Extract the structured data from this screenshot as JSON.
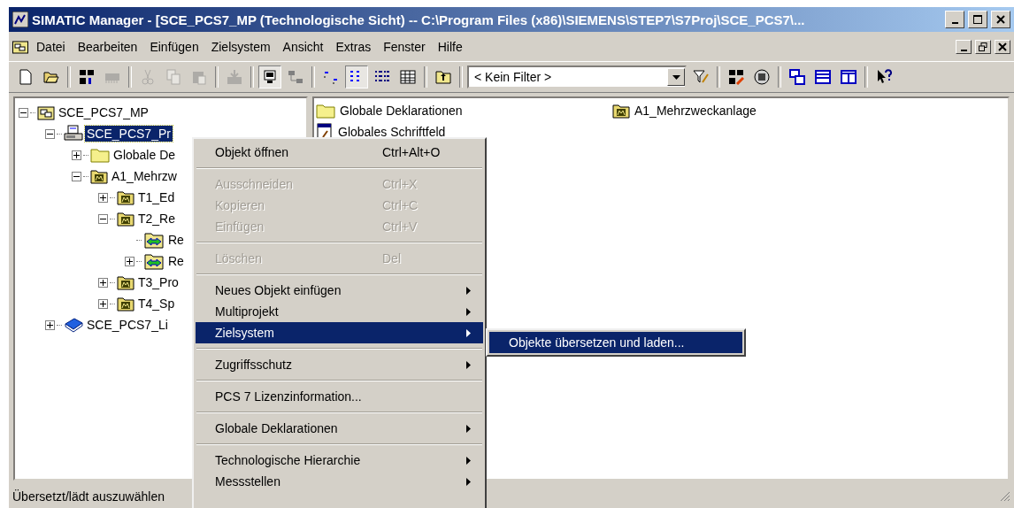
{
  "window": {
    "title": "SIMATIC Manager - [SCE_PCS7_MP (Technologische Sicht) -- C:\\Program Files (x86)\\SIEMENS\\STEP7\\S7Proj\\SCE_PCS7\\..."
  },
  "menu_bar": [
    "Datei",
    "Bearbeiten",
    "Einfügen",
    "Zielsystem",
    "Ansicht",
    "Extras",
    "Fenster",
    "Hilfe"
  ],
  "toolbar": [
    {
      "kind": "new",
      "pressed": false,
      "disabled": false
    },
    {
      "kind": "open",
      "pressed": false,
      "disabled": false
    },
    {
      "kind": "separator"
    },
    {
      "kind": "nodes",
      "pressed": false,
      "disabled": false
    },
    {
      "kind": "memory-card",
      "pressed": false,
      "disabled": true
    },
    {
      "kind": "separator"
    },
    {
      "kind": "cut",
      "pressed": false,
      "disabled": true
    },
    {
      "kind": "copy",
      "pressed": false,
      "disabled": true
    },
    {
      "kind": "paste",
      "pressed": false,
      "disabled": true
    },
    {
      "kind": "separator"
    },
    {
      "kind": "download",
      "pressed": false,
      "disabled": true
    },
    {
      "kind": "separator"
    },
    {
      "kind": "offline",
      "pressed": true,
      "disabled": false
    },
    {
      "kind": "online",
      "pressed": false,
      "disabled": false
    },
    {
      "kind": "separator"
    },
    {
      "kind": "large-icons",
      "pressed": false,
      "disabled": false
    },
    {
      "kind": "small-icons",
      "pressed": true,
      "disabled": false
    },
    {
      "kind": "list",
      "pressed": false,
      "disabled": false
    },
    {
      "kind": "details",
      "pressed": false,
      "disabled": false
    },
    {
      "kind": "separator"
    },
    {
      "kind": "up-level",
      "pressed": false,
      "disabled": false
    },
    {
      "kind": "separator"
    },
    {
      "kind": "filter-select",
      "value": "< Kein Filter >"
    },
    {
      "kind": "filter",
      "pressed": false,
      "disabled": false
    },
    {
      "kind": "separator"
    },
    {
      "kind": "network",
      "pressed": false,
      "disabled": false
    },
    {
      "kind": "simulation",
      "pressed": false,
      "disabled": false
    },
    {
      "kind": "separator"
    },
    {
      "kind": "cascade",
      "pressed": false,
      "disabled": false
    },
    {
      "kind": "tile-horizontal",
      "pressed": false,
      "disabled": false
    },
    {
      "kind": "tile-vertical",
      "pressed": false,
      "disabled": false
    },
    {
      "kind": "separator"
    },
    {
      "kind": "help",
      "pressed": false,
      "disabled": false
    }
  ],
  "tree": [
    {
      "label": "SCE_PCS7_MP",
      "kind": "multiproject",
      "expanded": true,
      "selected": false,
      "children": [
        {
          "label": "SCE_PCS7_Pr",
          "kind": "project",
          "expanded": true,
          "selected": true,
          "children": [
            {
              "label": "Globale De",
              "kind": "folder",
              "expanded": false,
              "selected": false
            },
            {
              "label": "A1_Mehrzw",
              "kind": "plant",
              "expanded": true,
              "selected": false,
              "children": [
                {
                  "label": "T1_Ed",
                  "kind": "plant",
                  "expanded": false,
                  "selected": false
                },
                {
                  "label": "T2_Re",
                  "kind": "plant",
                  "expanded": true,
                  "selected": false,
                  "children": [
                    {
                      "label": "Re",
                      "kind": "picture",
                      "selected": false
                    },
                    {
                      "label": "Re",
                      "kind": "picture",
                      "expanded": false,
                      "selected": false
                    }
                  ]
                },
                {
                  "label": "T3_Pro",
                  "kind": "plant",
                  "expanded": false,
                  "selected": false
                },
                {
                  "label": "T4_Sp",
                  "kind": "plant",
                  "expanded": false,
                  "selected": false
                }
              ]
            }
          ]
        },
        {
          "label": "SCE_PCS7_Li",
          "kind": "library",
          "expanded": false,
          "selected": false
        }
      ]
    }
  ],
  "list": [
    {
      "label": "Globale Deklarationen",
      "kind": "folder"
    },
    {
      "label": "Globales Schriftfeld",
      "kind": "form"
    },
    {
      "label": "A1_Mehrzweckanlage",
      "kind": "plant"
    }
  ],
  "context_menu": [
    {
      "kind": "item",
      "label": "Objekt öffnen",
      "shortcut": "Ctrl+Alt+O",
      "disabled": false,
      "submenu": false,
      "selected": false
    },
    {
      "kind": "separator"
    },
    {
      "kind": "item",
      "label": "Ausschneiden",
      "shortcut": "Ctrl+X",
      "disabled": true,
      "submenu": false,
      "selected": false
    },
    {
      "kind": "item",
      "label": "Kopieren",
      "shortcut": "Ctrl+C",
      "disabled": true,
      "submenu": false,
      "selected": false
    },
    {
      "kind": "item",
      "label": "Einfügen",
      "shortcut": "Ctrl+V",
      "disabled": true,
      "submenu": false,
      "selected": false
    },
    {
      "kind": "separator"
    },
    {
      "kind": "item",
      "label": "Löschen",
      "shortcut": "Del",
      "disabled": true,
      "submenu": false,
      "selected": false
    },
    {
      "kind": "separator"
    },
    {
      "kind": "item",
      "label": "Neues Objekt einfügen",
      "disabled": false,
      "submenu": true,
      "selected": false
    },
    {
      "kind": "item",
      "label": "Multiprojekt",
      "disabled": false,
      "submenu": true,
      "selected": false
    },
    {
      "kind": "item",
      "label": "Zielsystem",
      "disabled": false,
      "submenu": true,
      "selected": true
    },
    {
      "kind": "separator"
    },
    {
      "kind": "item",
      "label": "Zugriffsschutz",
      "disabled": false,
      "submenu": true,
      "selected": false
    },
    {
      "kind": "separator"
    },
    {
      "kind": "item",
      "label": "PCS 7 Lizenzinformation...",
      "disabled": false,
      "submenu": false,
      "selected": false
    },
    {
      "kind": "separator"
    },
    {
      "kind": "item",
      "label": "Globale Deklarationen",
      "disabled": false,
      "submenu": true,
      "selected": false
    },
    {
      "kind": "separator"
    },
    {
      "kind": "item",
      "label": "Technologische Hierarchie",
      "disabled": false,
      "submenu": true,
      "selected": false
    },
    {
      "kind": "item",
      "label": "Messstellen",
      "disabled": false,
      "submenu": true,
      "selected": false
    }
  ],
  "submenu": [
    {
      "label": "Objekte übersetzen und laden...",
      "selected": true
    }
  ],
  "status_bar": {
    "text": "Übersetzt/lädt auszuwählen"
  }
}
